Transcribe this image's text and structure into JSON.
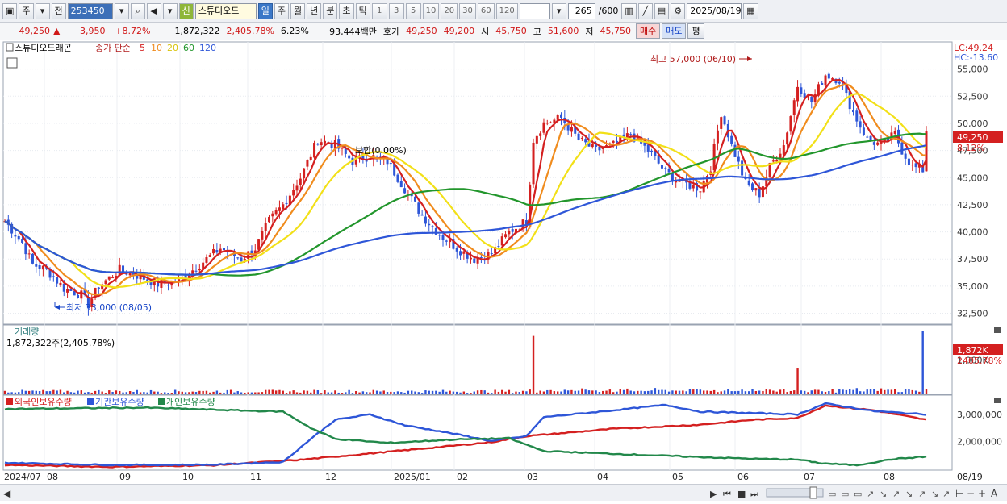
{
  "toolbar": {
    "market": "주",
    "mode": "전",
    "code": "253450",
    "badge_new": "신",
    "stock_name": "스튜디오드",
    "periods": [
      "일",
      "주",
      "월",
      "년",
      "분",
      "초",
      "틱"
    ],
    "active_period": "일",
    "intervals": [
      "1",
      "3",
      "5",
      "10",
      "20",
      "30",
      "60",
      "120"
    ],
    "count": "265",
    "count_max": "/600",
    "date": "2025/08/19"
  },
  "quote": {
    "price": "49,250",
    "change_arrow": "▲",
    "change": "3,950",
    "change_pct": "+8.72%",
    "volume": "1,872,322",
    "volume_ratio": "2,405.78%",
    "turnover_pct": "6.23%",
    "amount": "93,444백만",
    "ask_label": "호가",
    "ask": "49,250",
    "bid": "49,200",
    "open_label": "시",
    "open": "45,750",
    "high_label": "고",
    "high": "51,600",
    "low_label": "저",
    "low": "45,750",
    "buy_label": "매수",
    "sell_label": "매도",
    "eval_label": "평"
  },
  "price_panel": {
    "legend_name": "스튜디오드래곤",
    "legend_ma_label": "종가 단순",
    "ma_periods": [
      "5",
      "10",
      "20",
      "60",
      "120"
    ],
    "ma_colors": [
      "#d42020",
      "#f08c1e",
      "#f2e018",
      "#22962c",
      "#2e56d8"
    ],
    "lc_label": "LC:49.24",
    "hc_label": "HC:-13.60",
    "max_annotation": "최고 57,000 (06/10)",
    "min_annotation": "최저 33,000 (08/05)",
    "flat_annotation": "보합(0.00%)",
    "current_price_tag": "49,250",
    "current_pct_tag": "8.12%"
  },
  "volume_panel": {
    "title": "거래량",
    "value": "1,872,322주(2,405.78%)",
    "current_tag": "1,872K",
    "current_pct": "2405.78%"
  },
  "holdings_panel": {
    "series_names": [
      "외국인보유수량",
      "기관보유수량",
      "개인보유수량"
    ],
    "series_colors": [
      "#d42020",
      "#2e56d8",
      "#22884a"
    ]
  },
  "axis": {
    "x_labels": [
      "2024/07",
      "08",
      "09",
      "10",
      "11",
      "12",
      "2025/01",
      "02",
      "03",
      "04",
      "05",
      "06",
      "07",
      "08",
      "08/19"
    ],
    "price_ticks": [
      "55,000",
      "52,500",
      "50,000",
      "47,500",
      "45,000",
      "42,500",
      "40,000",
      "37,500",
      "35,000",
      "32,500"
    ],
    "volume_ticks": [
      "1,000K"
    ],
    "holdings_ticks": [
      "3,000,000",
      "2,000,000"
    ]
  },
  "chart_data": {
    "type": "candlestick",
    "price_range": [
      31500,
      57500
    ],
    "volume_range_k": [
      0,
      2000
    ],
    "holdings_range": [
      950000,
      3650000
    ],
    "month_labels": [
      "2024/07",
      "08",
      "09",
      "10",
      "11",
      "12",
      "2025/01",
      "02",
      "03",
      "04",
      "05",
      "06",
      "07",
      "08"
    ],
    "close_keypoints": [
      [
        0,
        41000
      ],
      [
        5,
        39000
      ],
      [
        8,
        37000
      ],
      [
        12,
        36500
      ],
      [
        17,
        34800
      ],
      [
        22,
        34200
      ],
      [
        24,
        33300
      ],
      [
        27,
        35000
      ],
      [
        33,
        36500
      ],
      [
        38,
        36000
      ],
      [
        44,
        35200
      ],
      [
        50,
        35500
      ],
      [
        56,
        37000
      ],
      [
        62,
        38500
      ],
      [
        68,
        37500
      ],
      [
        72,
        38500
      ],
      [
        76,
        41000
      ],
      [
        80,
        42500
      ],
      [
        85,
        45000
      ],
      [
        90,
        48500
      ],
      [
        95,
        48000
      ],
      [
        100,
        46500
      ],
      [
        105,
        47000
      ],
      [
        110,
        46500
      ],
      [
        115,
        44000
      ],
      [
        120,
        41500
      ],
      [
        125,
        39800
      ],
      [
        130,
        38500
      ],
      [
        135,
        37500
      ],
      [
        140,
        38000
      ],
      [
        145,
        40000
      ],
      [
        150,
        41000
      ],
      [
        152,
        48500
      ],
      [
        155,
        50000
      ],
      [
        160,
        50500
      ],
      [
        165,
        48500
      ],
      [
        170,
        47500
      ],
      [
        175,
        48000
      ],
      [
        180,
        49000
      ],
      [
        185,
        47500
      ],
      [
        190,
        45500
      ],
      [
        195,
        44500
      ],
      [
        200,
        44000
      ],
      [
        203,
        46000
      ],
      [
        206,
        51000
      ],
      [
        209,
        48000
      ],
      [
        213,
        44500
      ],
      [
        217,
        43500
      ],
      [
        220,
        46000
      ],
      [
        224,
        48000
      ],
      [
        228,
        53500
      ],
      [
        232,
        52000
      ],
      [
        236,
        54500
      ],
      [
        240,
        54000
      ],
      [
        244,
        51000
      ],
      [
        248,
        48500
      ],
      [
        252,
        48000
      ],
      [
        256,
        49000
      ],
      [
        258,
        47500
      ],
      [
        261,
        46000
      ],
      [
        264,
        45700
      ],
      [
        265,
        49250
      ]
    ],
    "volume_spikes": [
      {
        "bar": 152,
        "k": 1720
      },
      {
        "bar": 228,
        "k": 770
      },
      {
        "bar": 264,
        "k": 1872
      }
    ],
    "series": [
      {
        "name": "외국인보유수량",
        "keypoints": [
          [
            0,
            1140000
          ],
          [
            30,
            1070000
          ],
          [
            60,
            1130000
          ],
          [
            85,
            1330000
          ],
          [
            115,
            1680000
          ],
          [
            140,
            1980000
          ],
          [
            150,
            2200000
          ],
          [
            175,
            2470000
          ],
          [
            200,
            2620000
          ],
          [
            215,
            2800000
          ],
          [
            228,
            2870000
          ],
          [
            236,
            3330000
          ],
          [
            250,
            3150000
          ],
          [
            265,
            2800000
          ]
        ]
      },
      {
        "name": "기관보유수량",
        "keypoints": [
          [
            0,
            1220000
          ],
          [
            30,
            1140000
          ],
          [
            60,
            1150000
          ],
          [
            80,
            1250000
          ],
          [
            88,
            2100000
          ],
          [
            95,
            2800000
          ],
          [
            105,
            3000000
          ],
          [
            115,
            2600000
          ],
          [
            130,
            2270000
          ],
          [
            140,
            2020000
          ],
          [
            150,
            2200000
          ],
          [
            155,
            2900000
          ],
          [
            175,
            3150000
          ],
          [
            190,
            3350000
          ],
          [
            200,
            3100000
          ],
          [
            215,
            3050000
          ],
          [
            228,
            3000000
          ],
          [
            236,
            3400000
          ],
          [
            250,
            3120000
          ],
          [
            265,
            3000000
          ]
        ]
      },
      {
        "name": "개인보유수량",
        "keypoints": [
          [
            0,
            3200000
          ],
          [
            40,
            3250000
          ],
          [
            80,
            3100000
          ],
          [
            88,
            2500000
          ],
          [
            95,
            2100000
          ],
          [
            110,
            1950000
          ],
          [
            130,
            2080000
          ],
          [
            145,
            2120000
          ],
          [
            155,
            1650000
          ],
          [
            175,
            1550000
          ],
          [
            200,
            1430000
          ],
          [
            215,
            1370000
          ],
          [
            228,
            1340000
          ],
          [
            235,
            1200000
          ],
          [
            245,
            1130000
          ],
          [
            255,
            1350000
          ],
          [
            265,
            1450000
          ]
        ]
      }
    ]
  }
}
